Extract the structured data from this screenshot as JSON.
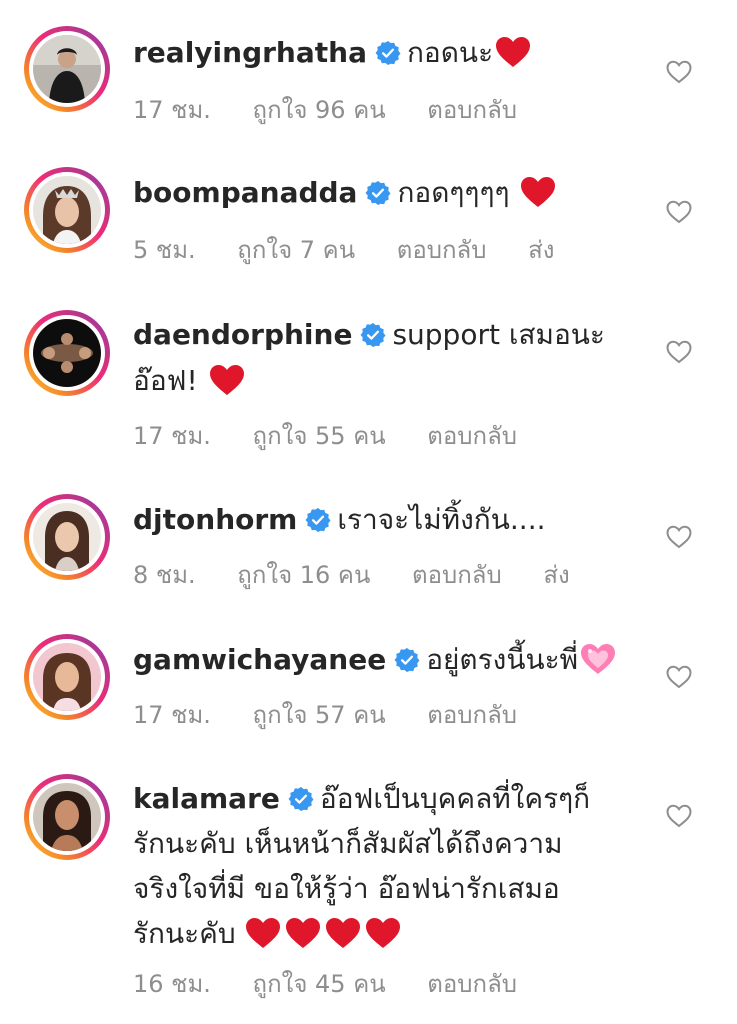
{
  "comments": [
    {
      "username": "realyingrhatha",
      "text": "กอดนะ",
      "time": "17 ชม.",
      "likes": "ถูกใจ 96 คน",
      "reply": "ตอบกลับ",
      "send": "",
      "emoji": [
        "red-heart"
      ]
    },
    {
      "username": "boompanadda",
      "text": "กอดๆๆๆๆ",
      "time": "5 ชม.",
      "likes": "ถูกใจ 7 คน",
      "reply": "ตอบกลับ",
      "send": "ส่ง",
      "emoji": [
        "red-heart"
      ]
    },
    {
      "username": "daendorphine",
      "text": "support เสมอนะ",
      "text2": "อ๊อฟ!",
      "time": "17 ชม.",
      "likes": "ถูกใจ 55 คน",
      "reply": "ตอบกลับ",
      "send": "",
      "emoji": [
        "red-heart"
      ]
    },
    {
      "username": "djtonhorm",
      "text": "เราจะไม่ทิ้งกัน....",
      "time": "8 ชม.",
      "likes": "ถูกใจ 16 คน",
      "reply": "ตอบกลับ",
      "send": "ส่ง",
      "emoji": []
    },
    {
      "username": "gamwichayanee",
      "text": "อยู่ตรงนี้นะพี่",
      "time": "17 ชม.",
      "likes": "ถูกใจ 57 คน",
      "reply": "ตอบกลับ",
      "send": "",
      "emoji": [
        "sparkling-heart"
      ]
    },
    {
      "username": "kalamare",
      "text": "อ๊อฟเป็นบุคคลที่ใครๆก็",
      "text2": "รักนะคับ เห็นหน้าก็สัมผัสได้ถึงความ",
      "text3": "จริงใจที่มี ขอให้รู้ว่า อ๊อฟน่ารักเสมอ",
      "text4": "รักนะคับ",
      "time": "16 ชม.",
      "likes": "ถูกใจ 45 คน",
      "reply": "ตอบกลับ",
      "send": "",
      "emoji": [
        "red-heart",
        "red-heart",
        "red-heart",
        "red-heart"
      ]
    }
  ],
  "colors": {
    "verified": "#3897f0",
    "heart": "#e0162b",
    "meta_text": "#8e8e8e",
    "text": "#262626"
  }
}
